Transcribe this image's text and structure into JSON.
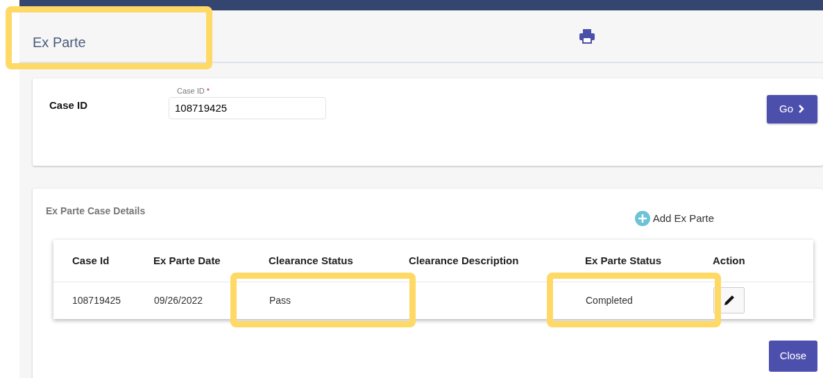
{
  "page": {
    "title": "Ex Parte",
    "title_highlighted": true
  },
  "search": {
    "label": "Case ID",
    "field_label": "Case ID",
    "required_mark": "*",
    "value": "108719425",
    "go_button": "Go"
  },
  "details": {
    "title": "Ex Parte Case Details",
    "add_label": "Add Ex Parte",
    "columns": [
      "Case Id",
      "Ex Parte Date",
      "Clearance Status",
      "Clearance Description",
      "Ex Parte Status",
      "Action"
    ],
    "rows": [
      {
        "cells": [
          {
            "text": "108719425"
          },
          {
            "text": "09/26/2022"
          },
          {
            "text": "Pass",
            "highlighted": true
          },
          {
            "text": ""
          },
          {
            "text": "Completed",
            "highlighted": true
          }
        ]
      }
    ],
    "close_button": "Close"
  }
}
